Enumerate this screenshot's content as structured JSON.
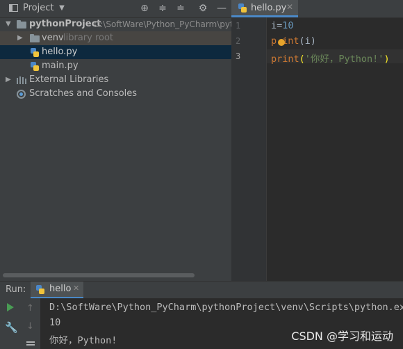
{
  "project_panel": {
    "title": "Project",
    "tree": {
      "root_name": "pythonProject",
      "root_path": "D:\\SoftWare\\Python_PyCharm\\pyth",
      "venv_label": "venv",
      "venv_note": "library root",
      "file1": "hello.py",
      "file2": "main.py",
      "external_libraries": "External Libraries",
      "scratches": "Scratches and Consoles"
    }
  },
  "editor": {
    "tab_label": "hello.py",
    "line_numbers": [
      "1",
      "2",
      "3"
    ],
    "lines": [
      {
        "var": "i",
        "op": "=",
        "num": "10"
      },
      {
        "fn_a": "p",
        "fn_b": "int",
        "args": "(i)"
      },
      {
        "fn": "print",
        "open": "(",
        "str": "'你好，Python!'",
        "close": ")"
      }
    ]
  },
  "run_panel": {
    "label": "Run:",
    "tab_label": "hello",
    "output": [
      "D:\\SoftWare\\Python_PyCharm\\pythonProject\\venv\\Scripts\\python.exe",
      "10",
      "你好，Python!"
    ]
  },
  "watermark": "CSDN @学习和运动",
  "colors": {
    "keyword": "#cc7832",
    "number": "#6897bb",
    "string": "#6a8759",
    "selection": "#0d293e",
    "accent": "#4a88c7"
  }
}
